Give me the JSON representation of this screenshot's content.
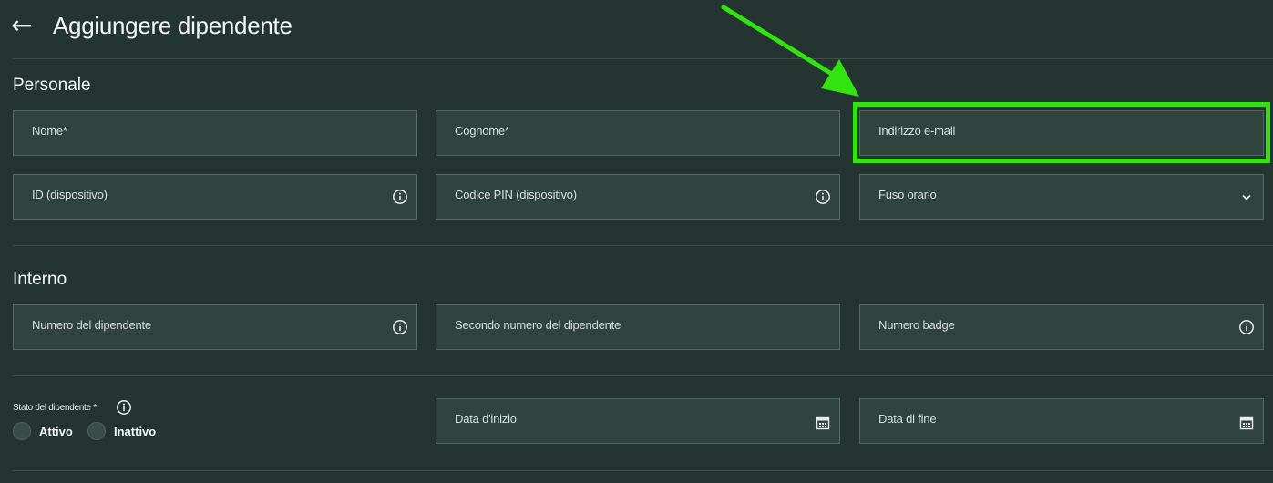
{
  "header": {
    "back_icon": "←",
    "title": "Aggiungere dipendente"
  },
  "sections": {
    "personal": {
      "title": "Personale",
      "first_name": "Nome*",
      "last_name": "Cognome*",
      "email": "Indirizzo e-mail",
      "device_id": "ID (dispositivo)",
      "device_pin": "Codice PIN (dispositivo)",
      "timezone": "Fuso orario"
    },
    "internal": {
      "title": "Interno",
      "employee_number": "Numero del dipendente",
      "second_employee_number": "Secondo numero del dipendente",
      "badge_number": "Numero badge"
    },
    "status": {
      "label": "Stato del dipendente *",
      "options": [
        "Attivo",
        "Inattivo"
      ],
      "start_date": "Data d'inizio",
      "end_date": "Data di fine"
    }
  },
  "annotation": {
    "color": "#33e30f",
    "target": "email-field"
  },
  "colors": {
    "background": "#233431",
    "field_bg": "#2f443f",
    "field_border": "#546862"
  }
}
